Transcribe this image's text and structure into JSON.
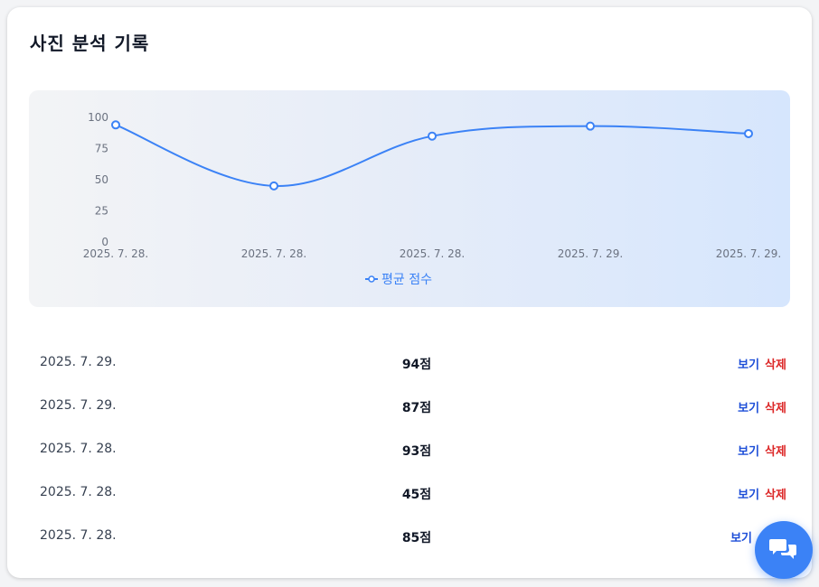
{
  "page": {
    "title": "사진 분석 기록"
  },
  "chart_data": {
    "type": "line",
    "categories": [
      "2025. 7. 28.",
      "2025. 7. 28.",
      "2025. 7. 28.",
      "2025. 7. 29.",
      "2025. 7. 29."
    ],
    "series": [
      {
        "name": "평균 점수",
        "values": [
          94,
          45,
          85,
          93,
          87
        ]
      }
    ],
    "ylim": [
      0,
      100
    ],
    "yticks": [
      0,
      25,
      50,
      75,
      100
    ],
    "grid": false,
    "legend": "bottom-center",
    "color": "#3b82f6"
  },
  "records": [
    {
      "date": "2025. 7. 29.",
      "score": "94점",
      "view": "보기",
      "delete": "삭제"
    },
    {
      "date": "2025. 7. 29.",
      "score": "87점",
      "view": "보기",
      "delete": "삭제"
    },
    {
      "date": "2025. 7. 28.",
      "score": "93점",
      "view": "보기",
      "delete": "삭제"
    },
    {
      "date": "2025. 7. 28.",
      "score": "45점",
      "view": "보기",
      "delete": "삭제"
    },
    {
      "date": "2025. 7. 28.",
      "score": "85점",
      "view": "보기",
      "delete": ""
    }
  ],
  "fab": {
    "icon": "chat-bubbles-icon",
    "color": "#3b82f6"
  }
}
